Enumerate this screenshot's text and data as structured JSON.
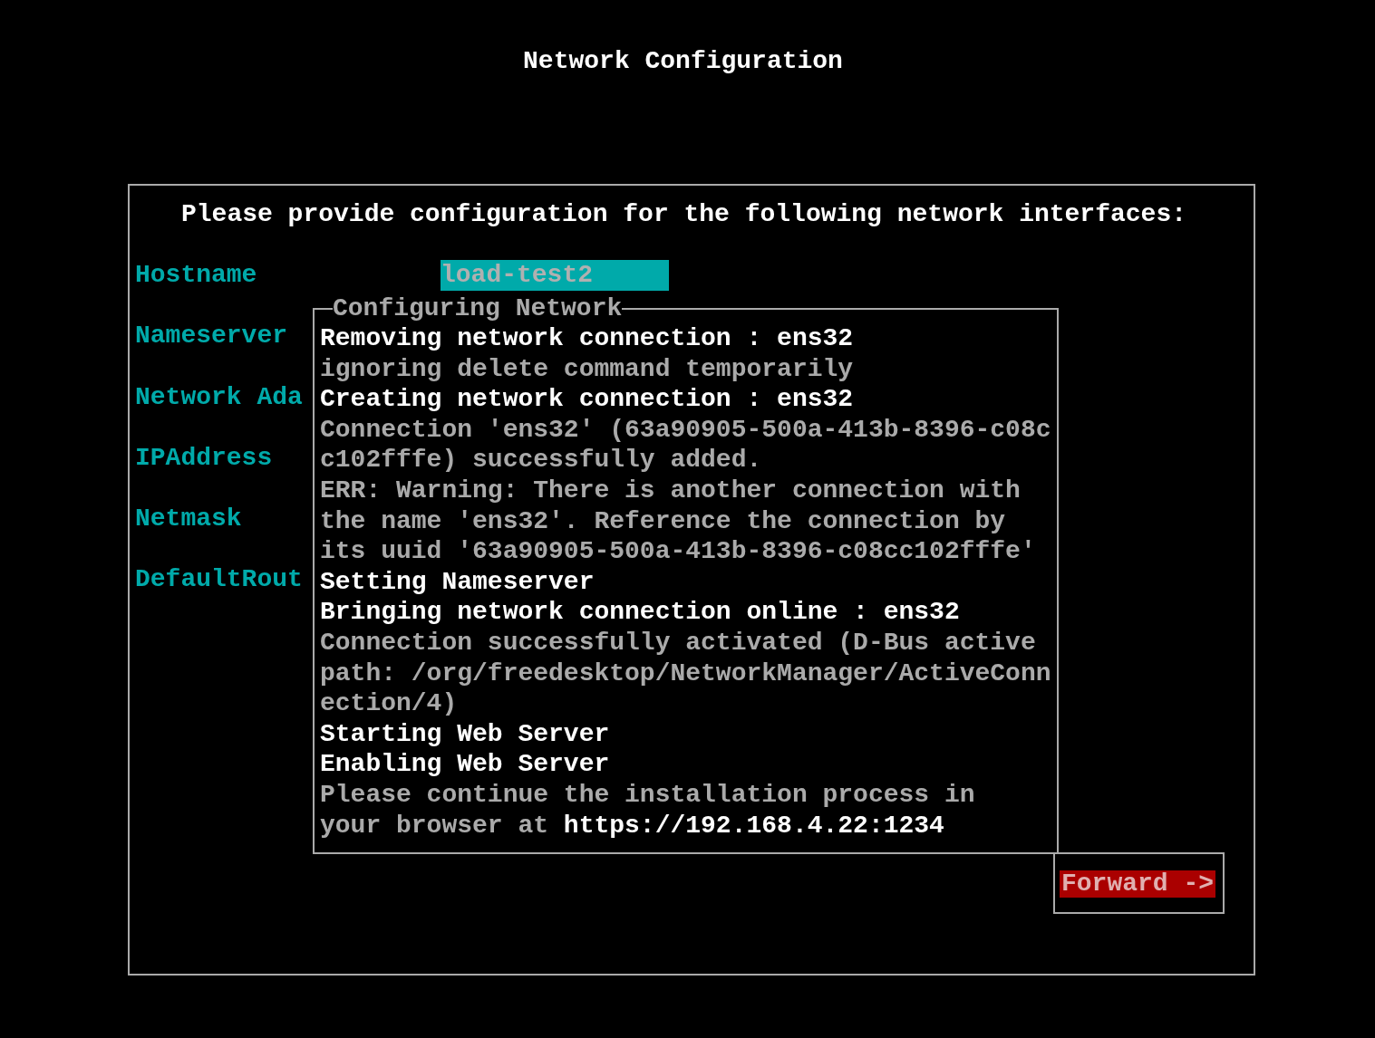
{
  "title": "Network Configuration",
  "form": {
    "heading": "Please provide configuration for the following network interfaces:",
    "fields": [
      {
        "label": "Hostname",
        "value": "load-test2"
      },
      {
        "label": "Nameserver"
      },
      {
        "label": "Network Ada"
      },
      {
        "label": "IPAddress"
      },
      {
        "label": "Netmask"
      },
      {
        "label": "DefaultRout"
      }
    ]
  },
  "dialog": {
    "title": "Configuring Network",
    "lines": [
      {
        "kind": "status",
        "text": "Removing network connection : ens32"
      },
      {
        "kind": "detail",
        "text": "ignoring delete command temporarily"
      },
      {
        "kind": "status",
        "text": "Creating network connection : ens32"
      },
      {
        "kind": "detail",
        "text": "Connection 'ens32' (63a90905-500a-413b-8396-c08c"
      },
      {
        "kind": "detail",
        "text": "c102fffe) successfully added."
      },
      {
        "kind": "detail",
        "text": "ERR: Warning: There is another connection with"
      },
      {
        "kind": "detail",
        "text": "the name 'ens32'. Reference the connection by"
      },
      {
        "kind": "detail",
        "text": "its uuid '63a90905-500a-413b-8396-c08cc102fffe'"
      },
      {
        "kind": "status",
        "text": "Setting Nameserver"
      },
      {
        "kind": "status",
        "text": "Bringing network connection online : ens32"
      },
      {
        "kind": "detail",
        "text": "Connection successfully activated (D-Bus active"
      },
      {
        "kind": "detail",
        "text": "path: /org/freedesktop/NetworkManager/ActiveConn"
      },
      {
        "kind": "detail",
        "text": "ection/4)"
      },
      {
        "kind": "status",
        "text": "Starting Web Server"
      },
      {
        "kind": "status",
        "text": "Enabling Web Server"
      },
      {
        "kind": "detail",
        "text": "Please continue the installation process in"
      },
      {
        "kind": "detail",
        "text": "your browser at ",
        "url": "https://192.168.4.22:1234"
      }
    ]
  },
  "buttons": [
    {
      "label": "Forward ->",
      "focused": true
    }
  ]
}
